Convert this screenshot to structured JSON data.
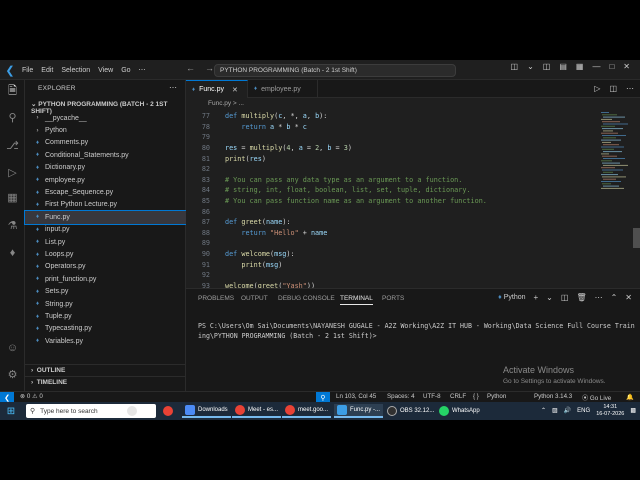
{
  "titlebar": {
    "menus": [
      "File",
      "Edit",
      "Selection",
      "View",
      "Go",
      "⋯"
    ],
    "search": "PYTHON PROGRAMMING (Batch - 2 1st Shift)"
  },
  "sidebar": {
    "header": "EXPLORER",
    "project": "PYTHON PROGRAMMING (BATCH - 2 1ST SHIFT)",
    "files": [
      {
        "name": "__pycache__",
        "type": "folder"
      },
      {
        "name": "Python",
        "type": "folder"
      },
      {
        "name": "Comments.py",
        "type": "py"
      },
      {
        "name": "Conditional_Statements.py",
        "type": "py"
      },
      {
        "name": "Dictionary.py",
        "type": "py"
      },
      {
        "name": "employee.py",
        "type": "py"
      },
      {
        "name": "Escape_Sequence.py",
        "type": "py"
      },
      {
        "name": "First Python Lecture.py",
        "type": "py"
      },
      {
        "name": "Func.py",
        "type": "py",
        "active": true
      },
      {
        "name": "input.py",
        "type": "py"
      },
      {
        "name": "List.py",
        "type": "py"
      },
      {
        "name": "Loops.py",
        "type": "py"
      },
      {
        "name": "Operators.py",
        "type": "py"
      },
      {
        "name": "print_function.py",
        "type": "py"
      },
      {
        "name": "Sets.py",
        "type": "py"
      },
      {
        "name": "String.py",
        "type": "py"
      },
      {
        "name": "Tuple.py",
        "type": "py"
      },
      {
        "name": "Typecasting.py",
        "type": "py"
      },
      {
        "name": "Variables.py",
        "type": "py"
      }
    ],
    "outline": "OUTLINE",
    "timeline": "TIMELINE"
  },
  "tabs": [
    {
      "label": "Func.py",
      "active": true
    },
    {
      "label": "employee.py",
      "active": false
    }
  ],
  "breadcrumb": "Func.py > ...",
  "editor": {
    "lines": [
      {
        "n": "77",
        "tokens": [
          [
            "kw",
            "def "
          ],
          [
            "fn",
            "multiply"
          ],
          [
            "op",
            "("
          ],
          [
            "var",
            "c"
          ],
          [
            "op",
            ", *, "
          ],
          [
            "var",
            "a"
          ],
          [
            "op",
            ", "
          ],
          [
            "var",
            "b"
          ],
          [
            "op",
            "):"
          ]
        ]
      },
      {
        "n": "78",
        "tokens": [
          [
            "op",
            "    "
          ],
          [
            "kw",
            "return "
          ],
          [
            "var",
            "a"
          ],
          [
            "op",
            " * "
          ],
          [
            "var",
            "b"
          ],
          [
            "op",
            " * "
          ],
          [
            "var",
            "c"
          ]
        ]
      },
      {
        "n": "79",
        "tokens": []
      },
      {
        "n": "80",
        "tokens": [
          [
            "var",
            "res"
          ],
          [
            "op",
            " = "
          ],
          [
            "fn",
            "multiply"
          ],
          [
            "op",
            "("
          ],
          [
            "num",
            "4"
          ],
          [
            "op",
            ", "
          ],
          [
            "var",
            "a"
          ],
          [
            "op",
            " = "
          ],
          [
            "num",
            "2"
          ],
          [
            "op",
            ", "
          ],
          [
            "var",
            "b"
          ],
          [
            "op",
            " = "
          ],
          [
            "num",
            "3"
          ],
          [
            "op",
            ")"
          ]
        ]
      },
      {
        "n": "81",
        "tokens": [
          [
            "fn",
            "print"
          ],
          [
            "op",
            "("
          ],
          [
            "var",
            "res"
          ],
          [
            "op",
            ")"
          ]
        ]
      },
      {
        "n": "82",
        "tokens": []
      },
      {
        "n": "83",
        "tokens": [
          [
            "cmt",
            "# You can pass any data type as an argument to a function."
          ]
        ]
      },
      {
        "n": "84",
        "tokens": [
          [
            "cmt",
            "# string, int, float, boolean, list, set, tuple, dictionary."
          ]
        ]
      },
      {
        "n": "85",
        "tokens": [
          [
            "cmt",
            "# You can pass function name as an argument to another function."
          ]
        ]
      },
      {
        "n": "86",
        "tokens": []
      },
      {
        "n": "87",
        "tokens": [
          [
            "kw",
            "def "
          ],
          [
            "fn",
            "greet"
          ],
          [
            "op",
            "("
          ],
          [
            "var",
            "name"
          ],
          [
            "op",
            "):"
          ]
        ]
      },
      {
        "n": "88",
        "tokens": [
          [
            "op",
            "    "
          ],
          [
            "kw",
            "return "
          ],
          [
            "str",
            "\"Hello\""
          ],
          [
            "op",
            " + "
          ],
          [
            "var",
            "name"
          ]
        ]
      },
      {
        "n": "89",
        "tokens": []
      },
      {
        "n": "90",
        "tokens": [
          [
            "kw",
            "def "
          ],
          [
            "fn",
            "welcome"
          ],
          [
            "op",
            "("
          ],
          [
            "var",
            "msg"
          ],
          [
            "op",
            "):"
          ]
        ]
      },
      {
        "n": "91",
        "tokens": [
          [
            "op",
            "    "
          ],
          [
            "fn",
            "print"
          ],
          [
            "op",
            "("
          ],
          [
            "var",
            "msg"
          ],
          [
            "op",
            ")"
          ]
        ]
      },
      {
        "n": "92",
        "tokens": []
      },
      {
        "n": "93",
        "tokens": [
          [
            "fn",
            "welcome"
          ],
          [
            "op",
            "("
          ],
          [
            "fn",
            "greet"
          ],
          [
            "op",
            "("
          ],
          [
            "str",
            "\"Yash\""
          ],
          [
            "op",
            "))"
          ]
        ]
      }
    ]
  },
  "panel": {
    "tabs": [
      "PROBLEMS",
      "OUTPUT",
      "DEBUG CONSOLE",
      "TERMINAL",
      "PORTS"
    ],
    "active_tab": "TERMINAL",
    "shell": "Python",
    "terminal_text": "PS C:\\Users\\Om Sai\\Documents\\NAYANESH GUGALE - A2Z Working\\A2Z IT HUB - Working\\Data Science Full Course Training\\PYTHON PROGRAMMING (Batch - 2 1st Shift)>",
    "watermark_title": "Activate Windows",
    "watermark_sub": "Go to Settings to activate Windows."
  },
  "statusbar": {
    "errors": "⊗ 0 ⚠ 0",
    "position": "Ln 103, Col 45",
    "spaces": "Spaces: 4",
    "encoding": "UTF-8",
    "eol": "CRLF",
    "braces": "{ }",
    "language": "Python",
    "interpreter": "Python 3.14.3",
    "golive": "Go Live"
  },
  "taskbar": {
    "search_placeholder": "Type here to search",
    "items": [
      "Downloads",
      "Meet - es...",
      "meet.goo...",
      "Func.py -...",
      "OBS 32.12...",
      "WhatsApp"
    ],
    "lang": "ENG",
    "time": "14:31",
    "date": "16-07-2026"
  }
}
